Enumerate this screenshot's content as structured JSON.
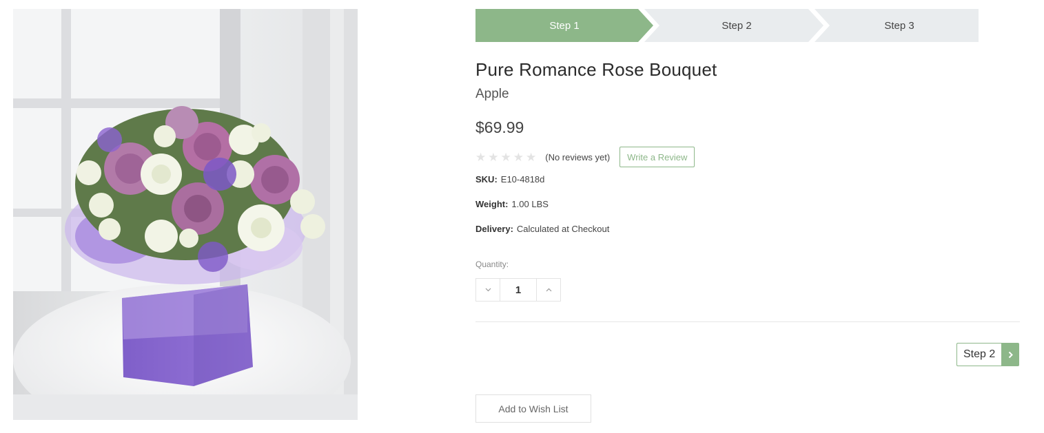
{
  "product_image": {
    "alt": "Pure Romance Rose Bouquet"
  },
  "steps": [
    {
      "label": "Step 1",
      "active": true
    },
    {
      "label": "Step 2",
      "active": false
    },
    {
      "label": "Step 3",
      "active": false
    }
  ],
  "product": {
    "title": "Pure Romance Rose Bouquet",
    "brand": "Apple",
    "price": "$69.99",
    "rating": 0,
    "reviews_text": "(No reviews yet)",
    "write_review_label": "Write a Review",
    "sku_label": "SKU:",
    "sku": "E10-4818d",
    "weight_label": "Weight:",
    "weight": "1.00 LBS",
    "delivery_label": "Delivery:",
    "delivery": "Calculated at Checkout"
  },
  "quantity": {
    "label": "Quantity:",
    "value": "1"
  },
  "actions": {
    "next_step_label": "Step 2",
    "wishlist_label": "Add to Wish List"
  },
  "colors": {
    "accent": "#8db789",
    "step_inactive": "#e9ecee",
    "star_empty": "#e3e3e3"
  },
  "icons": {
    "star": "star-icon",
    "decrement": "chevron-down-icon",
    "increment": "chevron-up-icon",
    "next": "chevron-right-icon"
  }
}
